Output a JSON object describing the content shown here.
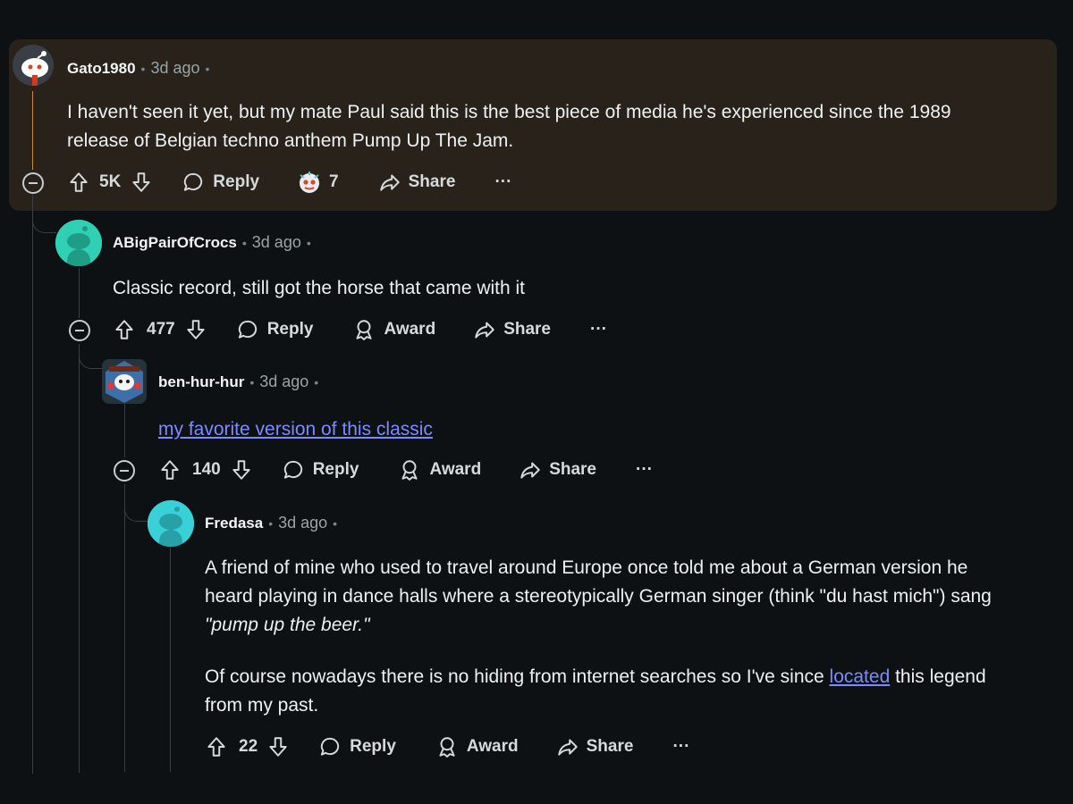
{
  "comments": [
    {
      "author": "Gato1980",
      "time": "3d ago",
      "body_lines": [
        "I haven't seen it yet, but my mate Paul said this is the best piece of media he's experienced since the 1989",
        "release of Belgian techno anthem Pump Up The Jam."
      ],
      "votes": "5K",
      "reply_label": "Reply",
      "award_count": "7",
      "share_label": "Share",
      "more_label": "···"
    },
    {
      "author": "ABigPairOfCrocs",
      "time": "3d ago",
      "body": "Classic record, still got the horse that came with it",
      "votes": "477",
      "reply_label": "Reply",
      "award_label": "Award",
      "share_label": "Share",
      "more_label": "···"
    },
    {
      "author": "ben-hur-hur",
      "time": "3d ago",
      "link_text": "my favorite version of this classic",
      "votes": "140",
      "reply_label": "Reply",
      "award_label": "Award",
      "share_label": "Share",
      "more_label": "···"
    },
    {
      "author": "Fredasa",
      "time": "3d ago",
      "p1_line1": "A friend of mine who used to travel around Europe once told me about a German version he",
      "p1_line2": "heard playing in dance halls where a stereotypically German singer (think \"du hast mich\") sang",
      "p1_italic": "\"pump up the beer.\"",
      "p2_before": "Of course nowadays there is no hiding from internet searches so I've since ",
      "p2_link": "located",
      "p2_after": " this legend",
      "p2_line2": "from my past.",
      "votes": "22",
      "reply_label": "Reply",
      "award_label": "Award",
      "share_label": "Share",
      "more_label": "···"
    }
  ],
  "icons": {
    "upvote": "upvote-icon",
    "downvote": "downvote-icon",
    "reply": "reply-bubble-icon",
    "award": "award-icon",
    "share": "share-arrow-icon",
    "collapse": "collapse-minus-icon"
  },
  "colors": {
    "background": "#0e1113",
    "highlight": "#28221a",
    "link": "#7a8cff",
    "thread_highlight": "#c58b3b"
  }
}
